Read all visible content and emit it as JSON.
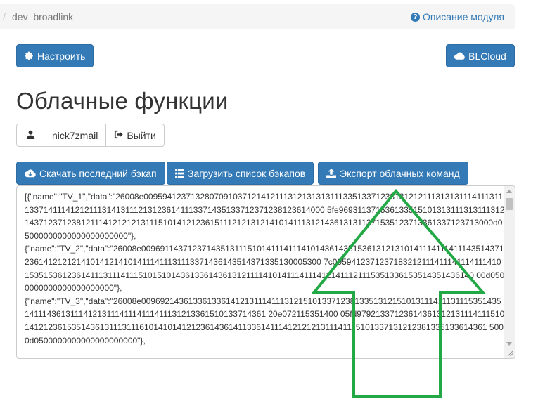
{
  "breadcrumb": {
    "separator": "/",
    "module": "dev_broadlink"
  },
  "help": {
    "label": "Описание модуля",
    "icon": "question-circle-icon"
  },
  "toolbar": {
    "configure_label": "Настроить",
    "configure_icon": "gear-icon",
    "blcloud_label": "BLCloud",
    "blcloud_icon": "cloud-icon"
  },
  "page": {
    "title": "Облачные функции"
  },
  "user": {
    "icon": "user-icon",
    "name": "nick7zmail",
    "logout_label": "Выйти",
    "logout_icon": "sign-out-icon"
  },
  "actions": [
    {
      "label": "Скачать последний бэкап",
      "icon": "cloud-download-icon"
    },
    {
      "label": "Загрузить список бэкапов",
      "icon": "list-icon"
    },
    {
      "label": "Экспорт облачных команд",
      "icon": "upload-icon"
    }
  ],
  "export": {
    "text": "[{\"name\":\"TV_1\",\"data\":\"26008e00959412371328070910371214121113121313131113351337123813121211131313111411131113371411141212111314131112131236141113371435133712371238123614000 5fe96931137153613351510131311131311131214371237123812111412121213111510141212361511121213121410141113121436131311371535123713361337123713000d05000000000000000000000\"},\n{\"name\":\"TV_2\",\"data\":\"26008e00969114371237143513111510141114111410143614351536131213101411141114111435143712361412121214101412141014111411131113371436143514371335130005300 7c095941237123718321211141114111411141015351536123614111311141115101510143613361436131211114101411141114121411121115351336153514351436140 00d0500000000000000000000\"},\n{\"name\":\"TV_3\",\"data\":\"26008e00969214361336133614121311141113121510133712381335131215101311141113111535143514111436131114121311141114111411131213361510133714361 20e072115351400 05fd979213371236143613121311141115101412123615351436131113111610141014121236143614113361411141212121311141115101337131212381335133614361 5000d0500000000000000000000\"},"
  },
  "annotation": {
    "color": "#22a845",
    "shape": "up-arrow"
  }
}
